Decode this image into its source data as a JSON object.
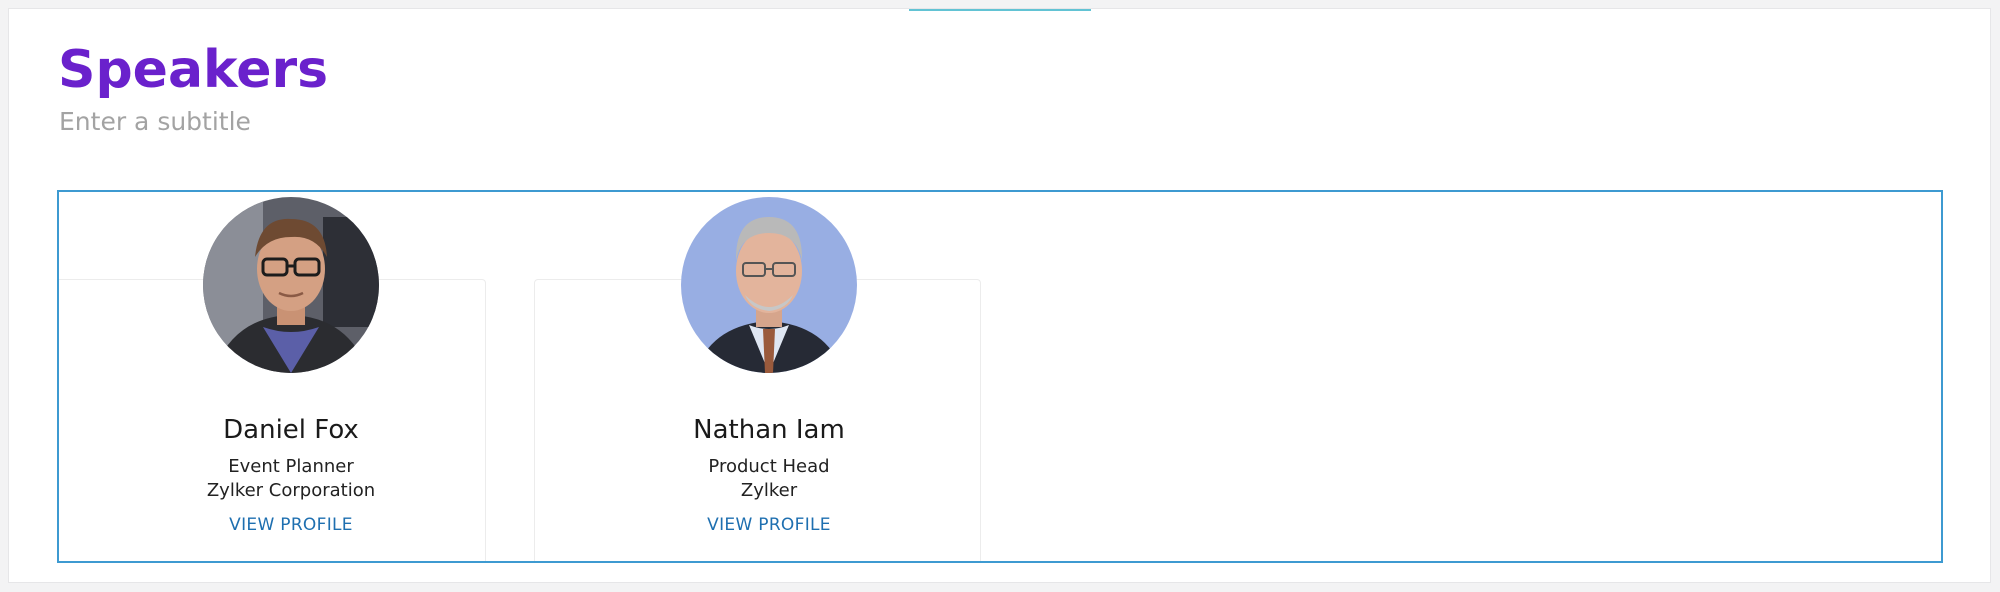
{
  "section": {
    "title": "Speakers",
    "subtitle": "Enter a subtitle"
  },
  "speakers": [
    {
      "name": "Daniel Fox",
      "role": "Event Planner",
      "company": "Zylker Corporation",
      "link_label": "VIEW PROFILE"
    },
    {
      "name": "Nathan Iam",
      "role": "Product Head",
      "company": "Zylker",
      "link_label": "VIEW PROFILE"
    }
  ],
  "colors": {
    "title": "#6a21cc",
    "subtitle": "#a3a3a3",
    "selection_border": "#3d9ad1",
    "link": "#1e6fb0",
    "avatar_bg_second": "#98aee3"
  }
}
